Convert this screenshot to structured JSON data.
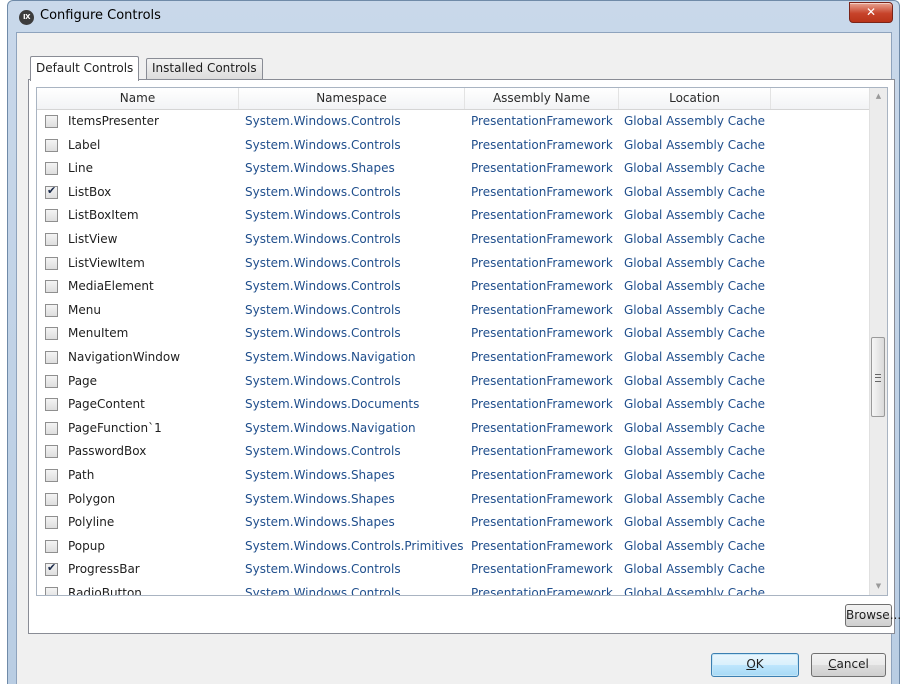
{
  "window": {
    "title": "Configure Controls",
    "icon_text": "IX",
    "close_label": "✕"
  },
  "tabs": [
    {
      "label": "Default Controls",
      "active": true
    },
    {
      "label": "Installed Controls",
      "active": false
    }
  ],
  "table": {
    "columns": [
      "Name",
      "Namespace",
      "Assembly Name",
      "Location"
    ],
    "rows": [
      {
        "checked": false,
        "name": "ItemsPresenter",
        "namespace": "System.Windows.Controls",
        "assembly": "PresentationFramework",
        "location": "Global Assembly Cache"
      },
      {
        "checked": false,
        "name": "Label",
        "namespace": "System.Windows.Controls",
        "assembly": "PresentationFramework",
        "location": "Global Assembly Cache"
      },
      {
        "checked": false,
        "name": "Line",
        "namespace": "System.Windows.Shapes",
        "assembly": "PresentationFramework",
        "location": "Global Assembly Cache"
      },
      {
        "checked": true,
        "name": "ListBox",
        "namespace": "System.Windows.Controls",
        "assembly": "PresentationFramework",
        "location": "Global Assembly Cache"
      },
      {
        "checked": false,
        "name": "ListBoxItem",
        "namespace": "System.Windows.Controls",
        "assembly": "PresentationFramework",
        "location": "Global Assembly Cache"
      },
      {
        "checked": false,
        "name": "ListView",
        "namespace": "System.Windows.Controls",
        "assembly": "PresentationFramework",
        "location": "Global Assembly Cache"
      },
      {
        "checked": false,
        "name": "ListViewItem",
        "namespace": "System.Windows.Controls",
        "assembly": "PresentationFramework",
        "location": "Global Assembly Cache"
      },
      {
        "checked": false,
        "name": "MediaElement",
        "namespace": "System.Windows.Controls",
        "assembly": "PresentationFramework",
        "location": "Global Assembly Cache"
      },
      {
        "checked": false,
        "name": "Menu",
        "namespace": "System.Windows.Controls",
        "assembly": "PresentationFramework",
        "location": "Global Assembly Cache"
      },
      {
        "checked": false,
        "name": "MenuItem",
        "namespace": "System.Windows.Controls",
        "assembly": "PresentationFramework",
        "location": "Global Assembly Cache"
      },
      {
        "checked": false,
        "name": "NavigationWindow",
        "namespace": "System.Windows.Navigation",
        "assembly": "PresentationFramework",
        "location": "Global Assembly Cache"
      },
      {
        "checked": false,
        "name": "Page",
        "namespace": "System.Windows.Controls",
        "assembly": "PresentationFramework",
        "location": "Global Assembly Cache"
      },
      {
        "checked": false,
        "name": "PageContent",
        "namespace": "System.Windows.Documents",
        "assembly": "PresentationFramework",
        "location": "Global Assembly Cache"
      },
      {
        "checked": false,
        "name": "PageFunction`1",
        "namespace": "System.Windows.Navigation",
        "assembly": "PresentationFramework",
        "location": "Global Assembly Cache"
      },
      {
        "checked": false,
        "name": "PasswordBox",
        "namespace": "System.Windows.Controls",
        "assembly": "PresentationFramework",
        "location": "Global Assembly Cache"
      },
      {
        "checked": false,
        "name": "Path",
        "namespace": "System.Windows.Shapes",
        "assembly": "PresentationFramework",
        "location": "Global Assembly Cache"
      },
      {
        "checked": false,
        "name": "Polygon",
        "namespace": "System.Windows.Shapes",
        "assembly": "PresentationFramework",
        "location": "Global Assembly Cache"
      },
      {
        "checked": false,
        "name": "Polyline",
        "namespace": "System.Windows.Shapes",
        "assembly": "PresentationFramework",
        "location": "Global Assembly Cache"
      },
      {
        "checked": false,
        "name": "Popup",
        "namespace": "System.Windows.Controls.Primitives",
        "assembly": "PresentationFramework",
        "location": "Global Assembly Cache"
      },
      {
        "checked": true,
        "name": "ProgressBar",
        "namespace": "System.Windows.Controls",
        "assembly": "PresentationFramework",
        "location": "Global Assembly Cache"
      },
      {
        "checked": false,
        "name": "RadioButton",
        "namespace": "System.Windows.Controls",
        "assembly": "PresentationFramework",
        "location": "Global Assembly Cache"
      }
    ]
  },
  "buttons": {
    "browse": "Browse...",
    "ok_key": "O",
    "ok_rest": "K",
    "cancel_key": "C",
    "cancel_rest": "ancel"
  },
  "scrollbar": {
    "up_icon": "▲",
    "down_icon": "▼",
    "position": 0.55
  },
  "colors": {
    "link_text": "#1f4e8c",
    "close": "#c7432a",
    "ok_border": "#3c7fb1"
  }
}
